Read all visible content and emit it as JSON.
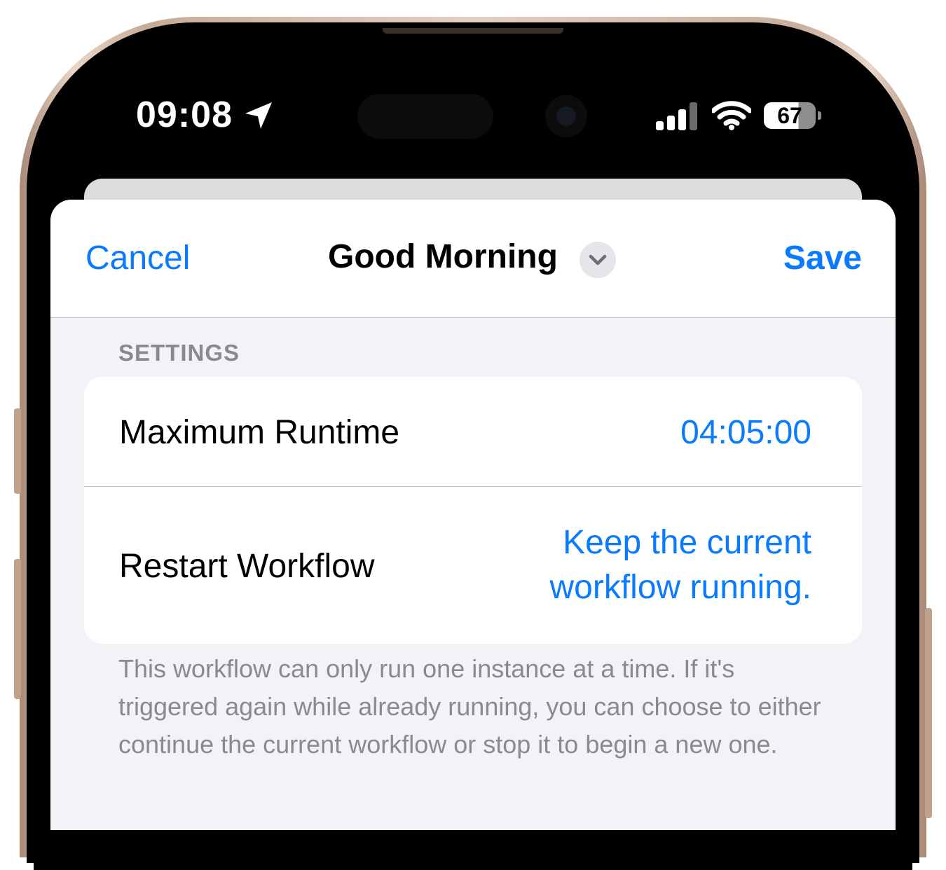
{
  "status_bar": {
    "time": "09:08",
    "battery_level": "67",
    "battery_fraction": 0.67,
    "icons": [
      "location-arrow-icon",
      "cellular-signal-icon",
      "wifi-icon",
      "battery-icon"
    ]
  },
  "nav": {
    "cancel_label": "Cancel",
    "title": "Good Morning",
    "save_label": "Save",
    "title_menu_icon": "chevron-down-icon"
  },
  "settings": {
    "section_header": "SETTINGS",
    "rows": [
      {
        "label": "Maximum Runtime",
        "value": "04:05:00"
      },
      {
        "label": "Restart Workflow",
        "value": "Keep the current workflow running."
      }
    ],
    "footer": "This workflow can only run one instance at a time. If it's triggered again while already running, you can choose to either continue the current workflow or stop it to begin a new one."
  },
  "colors": {
    "accent": "#0a7aff",
    "grouped_background": "#f2f2f7",
    "secondary_text": "#8a8a8e"
  }
}
